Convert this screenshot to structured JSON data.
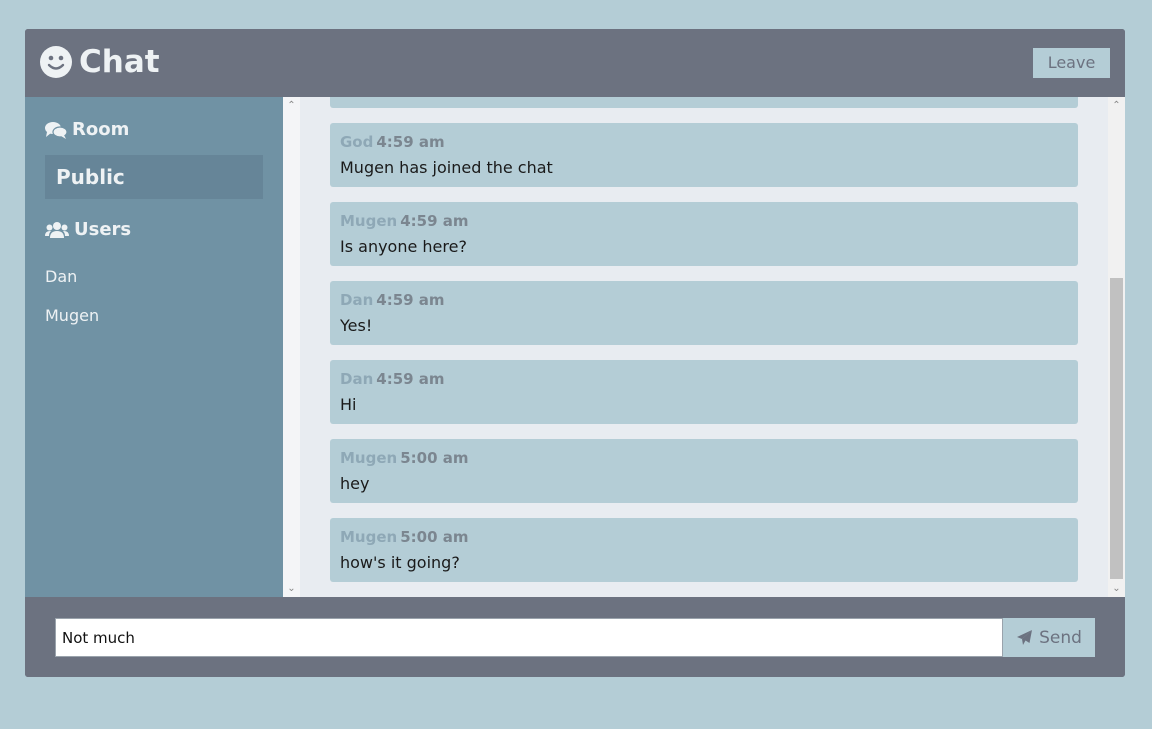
{
  "colors": {
    "page_bg": "#b4cdd6",
    "panel": "#6c7280",
    "sidebar": "#7092a4",
    "message_bg": "#b4cdd6",
    "messages_area": "#e8ecf1"
  },
  "header": {
    "title": "Chat",
    "logo_icon": "smiley-icon",
    "leave_label": "Leave"
  },
  "sidebar": {
    "room_heading": "Room",
    "room_icon": "comments-icon",
    "room_name": "Public",
    "users_heading": "Users",
    "users_icon": "users-icon",
    "users": [
      "Dan",
      "Mugen"
    ]
  },
  "messages": [
    {
      "user": "God",
      "time": "4:59 am",
      "text": "Mugen has joined the chat"
    },
    {
      "user": "Mugen",
      "time": "4:59 am",
      "text": "Is anyone here?"
    },
    {
      "user": "Dan",
      "time": "4:59 am",
      "text": "Yes!"
    },
    {
      "user": "Dan",
      "time": "4:59 am",
      "text": "Hi"
    },
    {
      "user": "Mugen",
      "time": "5:00 am",
      "text": "hey"
    },
    {
      "user": "Mugen",
      "time": "5:00 am",
      "text": "how's it going?"
    }
  ],
  "composer": {
    "value": "Not much",
    "send_label": "Send",
    "send_icon": "paper-plane-icon"
  }
}
